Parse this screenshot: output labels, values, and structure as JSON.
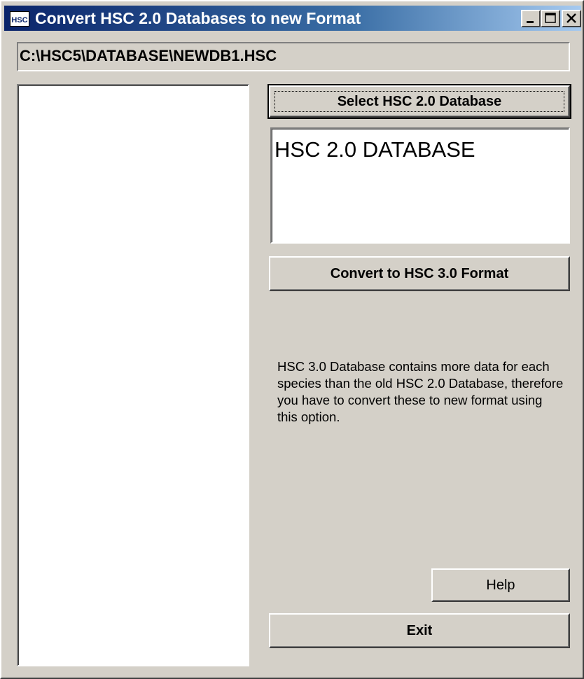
{
  "window": {
    "title": "Convert HSC 2.0 Databases to new Format",
    "icon": "hsc-app-icon",
    "icon_text": "HSC",
    "controls": {
      "minimize_icon": "minimize-icon",
      "maximize_icon": "maximize-icon",
      "close_icon": "close-icon"
    }
  },
  "path": {
    "value": "C:\\HSC5\\DATABASE\\NEWDB1.HSC"
  },
  "file_list": {
    "items": []
  },
  "buttons": {
    "select_label": "Select HSC 2.0 Database",
    "convert_label": "Convert to HSC 3.0 Format",
    "help_label": "Help",
    "exit_label": "Exit"
  },
  "database_display": {
    "text": "HSC 2.0 DATABASE"
  },
  "info": {
    "text": "HSC 3.0 Database contains more data for each species than the old HSC 2.0 Database, therefore you have to convert these to new format using this option."
  },
  "colors": {
    "titlebar_start": "#0a246a",
    "titlebar_end": "#a6caf0",
    "face": "#d4d0c8"
  }
}
